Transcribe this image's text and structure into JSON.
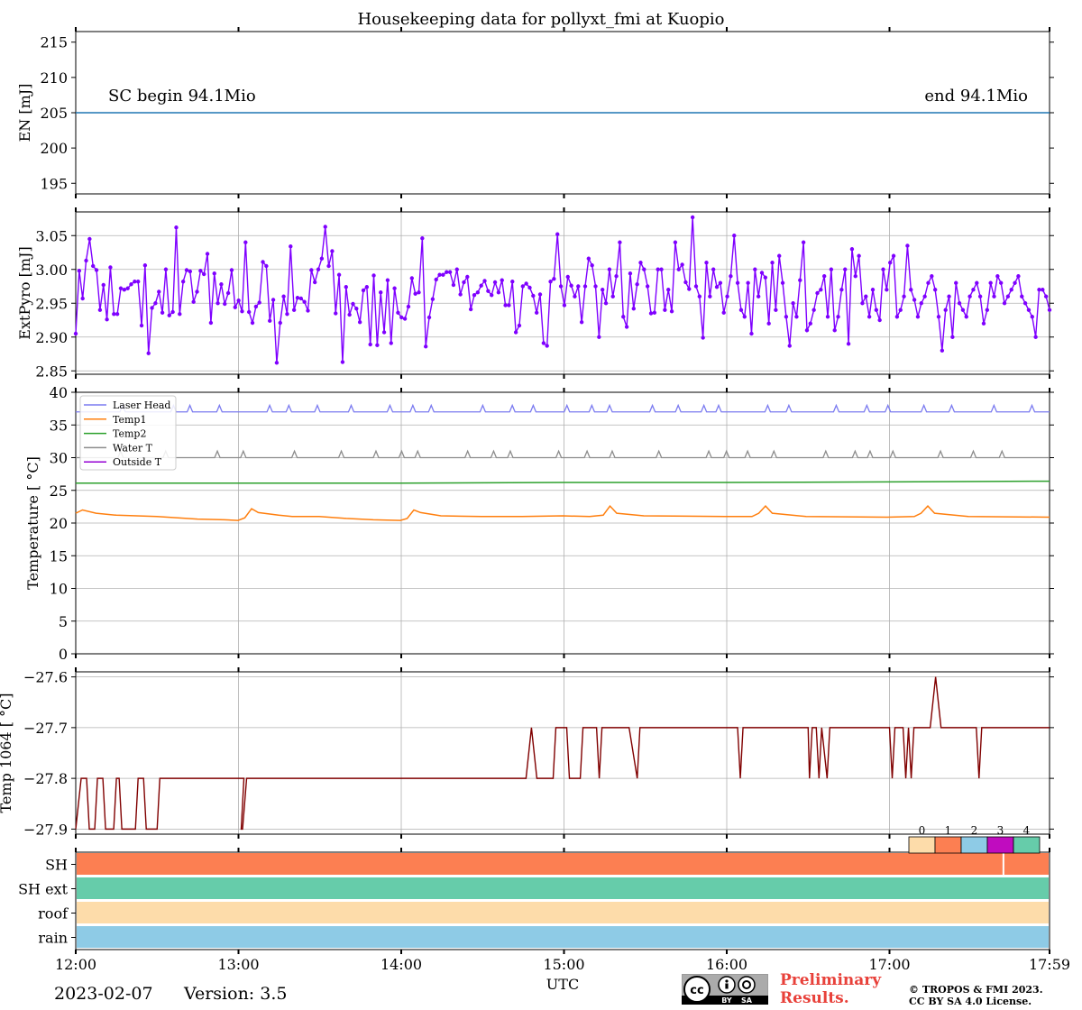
{
  "page": {
    "title": "Housekeeping data for pollyxt_fmi at Kuopio",
    "date": "2023-02-07",
    "version": "Version: 3.5",
    "preliminary_line1": "Preliminary",
    "preliminary_line2": "Results.",
    "copyright_line1": "© TROPOS & FMI 2023.",
    "copyright_line2": "CC BY SA 4.0 License.",
    "cc_badge": {
      "cc": "cc",
      "by": "BY",
      "sa": "SA"
    },
    "xlabel": "UTC",
    "xticks": [
      "12:00",
      "13:00",
      "14:00",
      "15:00",
      "16:00",
      "17:00",
      "17:59"
    ],
    "xtick_values": [
      0,
      60,
      120,
      180,
      240,
      300,
      359
    ],
    "xlim": [
      0,
      359
    ],
    "colors": {
      "energy": "#1f77b4",
      "extpyro": "#7f00ff",
      "laser_head": "#7b7bf0",
      "temp1": "#ff7f0e",
      "temp2": "#2ca02c",
      "water_t": "#8c8c8c",
      "outside_t": "#9400d3",
      "temp1064": "#800000"
    }
  },
  "chart_data": [
    {
      "type": "line",
      "id": "energy",
      "ylabel": "EN [mJ]",
      "ylim": [
        193.5,
        216.5
      ],
      "yticks": [
        195,
        200,
        205,
        210,
        215
      ],
      "grid": false,
      "annotation_left": "SC begin 94.1Mio",
      "annotation_right": "end 94.1Mio",
      "series": [
        {
          "x": [
            0,
            359
          ],
          "values": [
            205.0,
            205.0
          ]
        }
      ]
    },
    {
      "type": "line",
      "id": "extpyro",
      "ylabel": "ExtPyro [mJ]",
      "ylim": [
        2.845,
        3.085
      ],
      "yticks": [
        2.85,
        2.9,
        2.95,
        3.0,
        3.05
      ],
      "ytick_labels": [
        "2.85",
        "2.90",
        "2.95",
        "3.00",
        "3.05"
      ],
      "grid": true,
      "markers": true,
      "series": [
        {
          "x_step": 1.5,
          "x_start": 0,
          "values": [
            2.905,
            2.998,
            2.957,
            3.013,
            3.045,
            3.005,
            2.999,
            2.94,
            2.977,
            2.926,
            3.003,
            2.934,
            2.934,
            2.972,
            2.97,
            2.972,
            2.978,
            2.982,
            2.982,
            2.917,
            3.006,
            2.876,
            2.943,
            2.95,
            2.967,
            2.936,
            3.0,
            2.932,
            2.937,
            3.062,
            2.934,
            2.982,
            2.999,
            2.997,
            2.952,
            2.967,
            2.998,
            2.993,
            3.023,
            2.921,
            2.994,
            2.95,
            2.978,
            2.949,
            2.965,
            2.999,
            2.944,
            2.954,
            2.938,
            3.04,
            2.937,
            2.921,
            2.945,
            2.951,
            3.011,
            3.005,
            2.924,
            2.955,
            2.862,
            2.921,
            2.96,
            2.934,
            3.034,
            2.94,
            2.958,
            2.957,
            2.952,
            2.939,
            2.999,
            2.981,
            3.0,
            3.016,
            3.063,
            3.005,
            3.027,
            2.935,
            2.992,
            2.863,
            2.974,
            2.933,
            2.949,
            2.942,
            2.922,
            2.969,
            2.974,
            2.889,
            2.991,
            2.888,
            2.966,
            2.907,
            2.984,
            2.891,
            2.972,
            2.936,
            2.929,
            2.927,
            2.945,
            2.987,
            2.964,
            2.966,
            3.046,
            2.886,
            2.929,
            2.956,
            2.985,
            2.992,
            2.992,
            2.996,
            2.996,
            2.977,
            3.0,
            2.963,
            2.981,
            2.989,
            2.941,
            2.962,
            2.966,
            2.976,
            2.983,
            2.968,
            2.962,
            2.981,
            2.966,
            2.984,
            2.947,
            2.947,
            2.982,
            2.907,
            2.917,
            2.975,
            2.979,
            2.973,
            2.961,
            2.936,
            2.963,
            2.891,
            2.887,
            2.982,
            2.986,
            3.052,
            2.975,
            2.947,
            2.989,
            2.976,
            2.96,
            2.975,
            2.922,
            2.975,
            3.016,
            3.006,
            2.975,
            2.9,
            2.97,
            2.95,
            3.0,
            2.96,
            2.99,
            3.04,
            2.93,
            2.915,
            2.994,
            2.942,
            2.978,
            3.01,
            3.0,
            2.975,
            2.935,
            2.936,
            3.0,
            3.0,
            2.94,
            2.97,
            2.938,
            3.04,
            3.0,
            3.007,
            2.981,
            2.971,
            3.077,
            2.975,
            2.96,
            2.899,
            3.01,
            2.96,
            3.0,
            2.974,
            2.98,
            2.936,
            2.96,
            2.99,
            3.05,
            2.98,
            2.94,
            2.93,
            2.98,
            2.905,
            3.0,
            2.96,
            2.995,
            2.988,
            2.92,
            3.01,
            2.94,
            3.02,
            2.98,
            2.93,
            2.887,
            2.95,
            2.93,
            2.984,
            3.04,
            2.91,
            2.92,
            2.94,
            2.965,
            2.97,
            2.99,
            2.93,
            3.0,
            2.91,
            2.93,
            2.97,
            3.0,
            2.89,
            3.03,
            2.99,
            3.02,
            2.95,
            2.96,
            2.93,
            2.97,
            2.94,
            2.925,
            3.0,
            2.97,
            3.01,
            3.02,
            2.93,
            2.94,
            2.96,
            3.035,
            2.97,
            2.955,
            2.93,
            2.95,
            2.96,
            2.98,
            2.99,
            2.97,
            2.93,
            2.88,
            2.94,
            2.96,
            2.9,
            2.98,
            2.95,
            2.94,
            2.93,
            2.96,
            2.97,
            2.98,
            2.96,
            2.92,
            2.94,
            2.98,
            2.96,
            2.99,
            2.98,
            2.95,
            2.96,
            2.97,
            2.98,
            2.99,
            2.96,
            2.95,
            2.94,
            2.93,
            2.9,
            2.97,
            2.97,
            2.96,
            2.94
          ]
        }
      ]
    },
    {
      "type": "line",
      "id": "temperature",
      "ylabel": "Temperature [$^\\circ C$]",
      "ylabel_display": "Temperature [ °C]",
      "ylim": [
        0,
        40
      ],
      "yticks": [
        0,
        5,
        10,
        15,
        20,
        25,
        30,
        35,
        40
      ],
      "grid": true,
      "legend_position": "top-left",
      "series": [
        {
          "name": "Laser Head",
          "key": "laser_head",
          "base": 37.0,
          "alt": 38.0
        },
        {
          "name": "Temp1",
          "key": "temp1",
          "base": 21.0
        },
        {
          "name": "Temp2",
          "key": "temp2",
          "base": 26.2
        },
        {
          "name": "Water T",
          "key": "water_t",
          "base": 30.0,
          "alt": 31.0
        },
        {
          "name": "Outside T",
          "key": "outside_t",
          "values": []
        }
      ],
      "temp1_points": [
        [
          0,
          21.5
        ],
        [
          5,
          22.0
        ],
        [
          15,
          21.5
        ],
        [
          30,
          21.2
        ],
        [
          60,
          21.0
        ],
        [
          90,
          20.6
        ],
        [
          110,
          20.5
        ],
        [
          120,
          20.4
        ],
        [
          125,
          20.8
        ],
        [
          130,
          22.2
        ],
        [
          135,
          21.6
        ],
        [
          150,
          21.2
        ],
        [
          160,
          21.0
        ],
        [
          180,
          21.0
        ],
        [
          200,
          20.7
        ],
        [
          220,
          20.5
        ],
        [
          240,
          20.4
        ],
        [
          245,
          20.7
        ],
        [
          250,
          22.0
        ],
        [
          255,
          21.6
        ],
        [
          270,
          21.1
        ],
        [
          300,
          21.0
        ],
        [
          330,
          21.0
        ],
        [
          360,
          21.1
        ],
        [
          380,
          21.0
        ],
        [
          390,
          21.2
        ],
        [
          395,
          22.6
        ],
        [
          400,
          21.5
        ],
        [
          420,
          21.1
        ],
        [
          480,
          21.0
        ],
        [
          500,
          21.0
        ],
        [
          505,
          21.5
        ],
        [
          510,
          22.6
        ],
        [
          515,
          21.5
        ],
        [
          540,
          21.0
        ],
        [
          600,
          20.9
        ],
        [
          620,
          21.0
        ],
        [
          625,
          21.5
        ],
        [
          630,
          22.6
        ],
        [
          635,
          21.5
        ],
        [
          660,
          21.0
        ],
        [
          720,
          20.9
        ]
      ],
      "temp2_points": [
        [
          0,
          26.1
        ],
        [
          120,
          26.1
        ],
        [
          240,
          26.1
        ],
        [
          360,
          26.2
        ],
        [
          480,
          26.2
        ],
        [
          600,
          26.3
        ],
        [
          720,
          26.4
        ]
      ]
    },
    {
      "type": "line",
      "id": "temp1064",
      "ylabel": "Temp 1064 [$^\\circ C$]",
      "ylabel_display": "Temp 1064 [ °C]",
      "ylim": [
        -27.91,
        -27.59
      ],
      "yticks": [
        -27.9,
        -27.8,
        -27.7,
        -27.6
      ],
      "ytick_labels": [
        "−27.9",
        "−27.8",
        "−27.7",
        "−27.6"
      ],
      "grid": true,
      "series": [
        {
          "points": [
            [
              0,
              -27.9
            ],
            [
              2,
              -27.8
            ],
            [
              4,
              -27.8
            ],
            [
              5,
              -27.9
            ],
            [
              7,
              -27.9
            ],
            [
              8,
              -27.8
            ],
            [
              10,
              -27.8
            ],
            [
              11,
              -27.9
            ],
            [
              14,
              -27.9
            ],
            [
              15,
              -27.8
            ],
            [
              16,
              -27.8
            ],
            [
              17,
              -27.9
            ],
            [
              22,
              -27.9
            ],
            [
              23,
              -27.8
            ],
            [
              25,
              -27.8
            ],
            [
              26,
              -27.9
            ],
            [
              30,
              -27.9
            ],
            [
              31,
              -27.8
            ],
            [
              40,
              -27.8
            ],
            [
              41,
              -27.8
            ],
            [
              47,
              -27.8
            ],
            [
              48,
              -27.8
            ],
            [
              54,
              -27.8
            ],
            [
              55,
              -27.8
            ],
            [
              57,
              -27.8
            ],
            [
              60,
              -27.8
            ],
            [
              62,
              -27.8
            ],
            [
              61,
              -27.9
            ],
            [
              61.5,
              -27.9
            ],
            [
              63,
              -27.8
            ],
            [
              80,
              -27.8
            ],
            [
              85,
              -27.8
            ],
            [
              102,
              -27.8
            ],
            [
              103,
              -27.8
            ],
            [
              112,
              -27.8
            ],
            [
              113,
              -27.8
            ],
            [
              165,
              -27.8
            ],
            [
              166,
              -27.8
            ],
            [
              168,
              -27.7
            ],
            [
              170,
              -27.8
            ],
            [
              176,
              -27.8
            ],
            [
              177,
              -27.7
            ],
            [
              181,
              -27.7
            ],
            [
              182,
              -27.8
            ],
            [
              186,
              -27.8
            ],
            [
              187,
              -27.7
            ],
            [
              192,
              -27.7
            ],
            [
              193,
              -27.8
            ],
            [
              194,
              -27.7
            ],
            [
              195,
              -27.7
            ]
          ]
        }
      ]
    },
    {
      "type": "status-bars",
      "id": "status",
      "rows": [
        "SH",
        "SH ext",
        "roof",
        "rain"
      ],
      "row_status": [
        1,
        4,
        0,
        2
      ],
      "legend_labels": [
        "0",
        "1",
        "2",
        "3",
        "4"
      ],
      "legend_colors": [
        "#fddcaa",
        "#fc7f52",
        "#8ecbe6",
        "#c00cbf",
        "#66ccaa"
      ],
      "sh_gap_at": 342
    }
  ]
}
